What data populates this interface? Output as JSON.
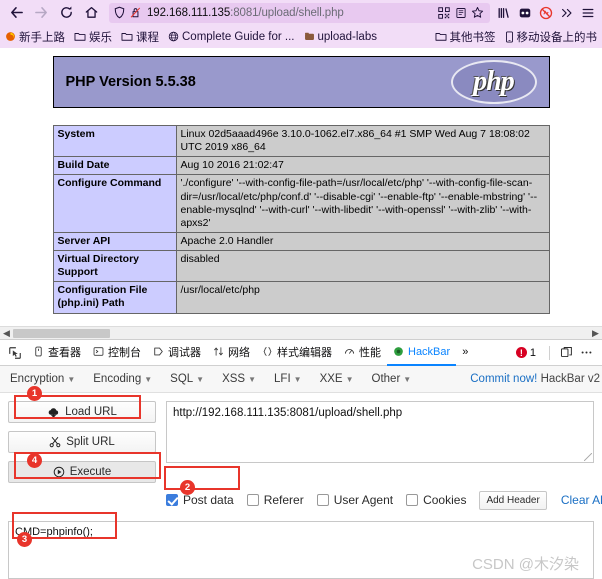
{
  "browser": {
    "nav": {
      "back": "back-arrow",
      "forward": "forward-arrow",
      "reload": "reload",
      "home": "home"
    },
    "urlbar": {
      "host": "192.168.111.135",
      "path": ":8081/upload/shell.php",
      "full_url": "192.168.111.135:8081/upload/shell.php",
      "shield_icon": "shield-icon",
      "permission_icon": "autoplay-blocked-icon",
      "qr_icon": "qr-code-icon",
      "reader_icon": "reader-mode-icon",
      "star_icon": "star-bookmark-icon"
    },
    "toolbar_icons": [
      "library-icon",
      "pocket-icon",
      "blocked-icon",
      "overflow-chevron-icon",
      "hamburger-menu-icon"
    ],
    "bookmarks": [
      {
        "label": "新手上路",
        "icon": "firefox-icon"
      },
      {
        "label": "娱乐",
        "icon": "folder-icon"
      },
      {
        "label": "课程",
        "icon": "folder-icon"
      },
      {
        "label": "Complete Guide for ...",
        "icon": "globe-icon"
      },
      {
        "label": "upload-labs",
        "icon": "site-icon"
      }
    ],
    "bookmarks_right": [
      {
        "label": "其他书签",
        "icon": "folder-icon"
      },
      {
        "label": "移动设备上的书",
        "icon": "mobile-icon"
      }
    ]
  },
  "page": {
    "php_version_title": "PHP Version 5.5.38",
    "php_logo_text": "php",
    "table": [
      {
        "key": "System",
        "value": "Linux 02d5aaad496e 3.10.0-1062.el7.x86_64 #1 SMP Wed Aug 7 18:08:02 UTC 2019 x86_64"
      },
      {
        "key": "Build Date",
        "value": "Aug 10 2016 21:02:47"
      },
      {
        "key": "Configure Command",
        "value": "'./configure' '--with-config-file-path=/usr/local/etc/php' '--with-config-file-scan-dir=/usr/local/etc/php/conf.d' '--disable-cgi' '--enable-ftp' '--enable-mbstring' '--enable-mysqlnd' '--with-curl' '--with-libedit' '--with-openssl' '--with-zlib' '--with-apxs2'"
      },
      {
        "key": "Server API",
        "value": "Apache 2.0 Handler"
      },
      {
        "key": "Virtual Directory Support",
        "value": "disabled"
      },
      {
        "key": "Configuration File (php.ini) Path",
        "value": "/usr/local/etc/php"
      }
    ]
  },
  "devtools": {
    "tabs": [
      {
        "label": "查看器",
        "icon": "inspector-icon",
        "active": false
      },
      {
        "label": "控制台",
        "icon": "console-icon",
        "active": false
      },
      {
        "label": "调试器",
        "icon": "debugger-icon",
        "active": false
      },
      {
        "label": "网络",
        "icon": "network-icon",
        "active": false
      },
      {
        "label": "样式编辑器",
        "icon": "style-editor-icon",
        "active": false
      },
      {
        "label": "性能",
        "icon": "performance-icon",
        "active": false
      },
      {
        "label": "HackBar",
        "icon": "hackbar-icon",
        "active": true
      }
    ],
    "overflow": "»",
    "error_count": "1",
    "dock_icon": "dock-layout-icon",
    "more_icon": "more-options-icon",
    "picker_icon": "element-picker-icon"
  },
  "hackbar": {
    "menus": [
      "Encryption",
      "Encoding",
      "SQL",
      "XSS",
      "LFI",
      "XXE",
      "Other"
    ],
    "commit_link": "Commit now!",
    "commit_version": "HackBar v2",
    "load_url_label": "Load URL",
    "split_url_label": "Split URL",
    "execute_label": "Execute",
    "url_value": "http://192.168.111.135:8081/upload/shell.php",
    "options": [
      {
        "label": "Post data",
        "checked": true
      },
      {
        "label": "Referer",
        "checked": false
      },
      {
        "label": "User Agent",
        "checked": false
      },
      {
        "label": "Cookies",
        "checked": false
      }
    ],
    "add_header_label": "Add Header",
    "clear_all_label": "Clear All",
    "post_data_value": "CMD=phpinfo();"
  },
  "annotations": {
    "marker1": "1",
    "marker2": "2",
    "marker3": "3",
    "marker4": "4"
  },
  "watermark": "CSDN @木汐染"
}
